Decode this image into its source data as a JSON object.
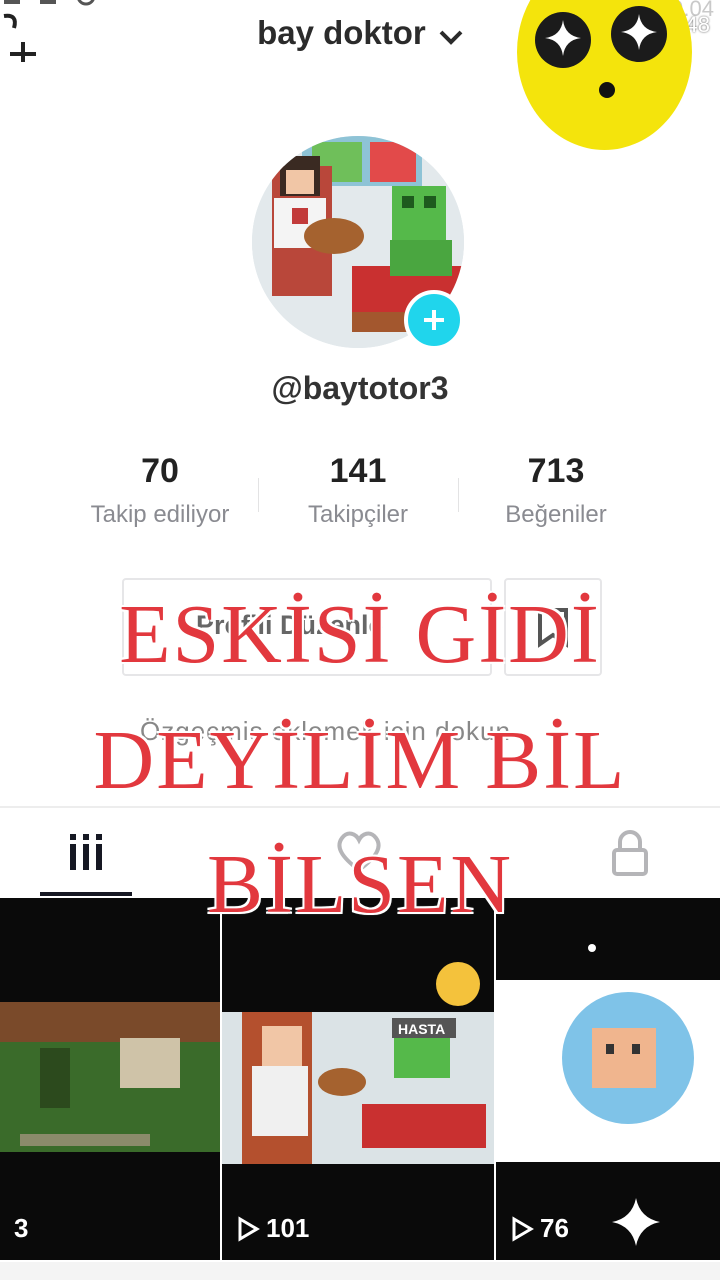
{
  "status": {
    "time_back": "%71 19.04",
    "time_front": "%37 23:48"
  },
  "header": {
    "title": "bay doktor"
  },
  "profile": {
    "username": "@baytotor3"
  },
  "stats": [
    {
      "value": "70",
      "label": "Takip ediliyor"
    },
    {
      "value": "141",
      "label": "Takipçiler"
    },
    {
      "value": "713",
      "label": "Beğeniler"
    }
  ],
  "actions": {
    "edit_profile": "Profili Düzenle"
  },
  "bio": {
    "placeholder": "Özgeçmiş eklemek için dokun"
  },
  "tabs": [
    {
      "icon": "grid-icon",
      "active": true
    },
    {
      "icon": "liked-icon",
      "active": false
    },
    {
      "icon": "lock-icon",
      "active": false
    }
  ],
  "videos": [
    {
      "views": "3"
    },
    {
      "views": "101",
      "sticker": "HASTA"
    },
    {
      "views": "76"
    }
  ],
  "overlay": {
    "line1": "ESKİSİ GİDİ",
    "line2": "DEYİLİM BİL",
    "line3": "BİLSEN"
  },
  "colors": {
    "accent": "#20d5ec",
    "overlay_text": "#e2383e",
    "emoji": "#f4e40c"
  }
}
